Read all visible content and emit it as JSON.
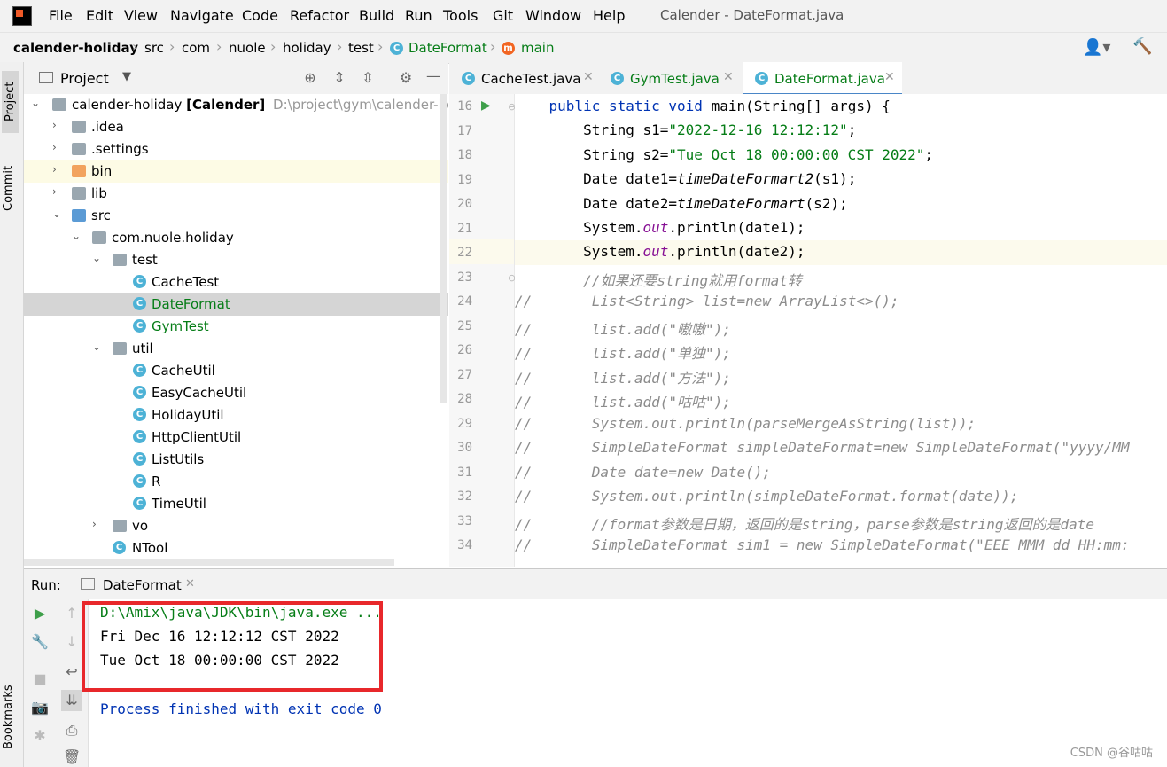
{
  "menu": [
    "File",
    "Edit",
    "View",
    "Navigate",
    "Code",
    "Refactor",
    "Build",
    "Run",
    "Tools",
    "Git",
    "Window",
    "Help"
  ],
  "window_title": "Calender - DateFormat.java",
  "breadcrumb": [
    "calender-holiday",
    "src",
    "com",
    "nuole",
    "holiday",
    "test",
    "DateFormat",
    "main"
  ],
  "left_stripe": {
    "project": "Project",
    "commit": "Commit",
    "bookmarks": "Bookmarks"
  },
  "project_panel": {
    "title": "Project"
  },
  "tree": [
    {
      "label": "calender-holiday",
      "bold": "[Calender]",
      "path": "D:\\project\\gym\\calender-holi"
    },
    {
      "label": ".idea"
    },
    {
      "label": ".settings"
    },
    {
      "label": "bin"
    },
    {
      "label": "lib"
    },
    {
      "label": "src"
    },
    {
      "label": "com.nuole.holiday"
    },
    {
      "label": "test"
    },
    {
      "label": "CacheTest"
    },
    {
      "label": "DateFormat"
    },
    {
      "label": "GymTest"
    },
    {
      "label": "util"
    },
    {
      "label": "CacheUtil"
    },
    {
      "label": "EasyCacheUtil"
    },
    {
      "label": "HolidayUtil"
    },
    {
      "label": "HttpClientUtil"
    },
    {
      "label": "ListUtils"
    },
    {
      "label": "R"
    },
    {
      "label": "TimeUtil"
    },
    {
      "label": "vo"
    },
    {
      "label": "NTool"
    }
  ],
  "editor_tabs": [
    "CacheTest.java",
    "GymTest.java",
    "DateFormat.java"
  ],
  "line_numbers": [
    "16",
    "17",
    "18",
    "19",
    "20",
    "21",
    "22",
    "23",
    "24",
    "25",
    "26",
    "27",
    "28",
    "29",
    "30",
    "31",
    "32",
    "33",
    "34"
  ],
  "code": {
    "l16": [
      "public static void ",
      "main(String[] args) {"
    ],
    "l17": [
      "String s1=",
      "\"2022-12-16 12:12:12\"",
      ";"
    ],
    "l18": [
      "String s2=",
      "\"Tue Oct 18 00:00:00 CST 2022\"",
      ";"
    ],
    "l19": [
      "Date date1=",
      "timeDateFormart2",
      "(s1);"
    ],
    "l20": [
      "Date date2=",
      "timeDateFormart",
      "(s2);"
    ],
    "l21": [
      "System.",
      "out",
      ".println(date1);"
    ],
    "l22": [
      "System.",
      "out",
      ".println(date2);"
    ],
    "l23": "//如果还要string就用format转",
    "l24": [
      "//",
      "    List<String> list=new ArrayList<>();"
    ],
    "l25": [
      "//",
      "    list.add(\"嗷嗷\");"
    ],
    "l26": [
      "//",
      "    list.add(\"单独\");"
    ],
    "l27": [
      "//",
      "    list.add(\"方法\");"
    ],
    "l28": [
      "//",
      "    list.add(\"咕咕\");"
    ],
    "l29": [
      "//",
      "    System.out.println(parseMergeAsString(list));"
    ],
    "l30": [
      "//",
      "    SimpleDateFormat simpleDateFormat=new SimpleDateFormat(\"yyyy/MM"
    ],
    "l31": [
      "//",
      "    Date date=new Date();"
    ],
    "l32": [
      "//",
      "    System.out.println(simpleDateFormat.format(date));"
    ],
    "l33": [
      "//",
      "    //format参数是日期，返回的是string，parse参数是string返回的是date"
    ],
    "l34": [
      "//",
      "    SimpleDateFormat sim1 = new SimpleDateFormat(\"EEE MMM dd HH:mm:"
    ]
  },
  "run": {
    "label": "Run:",
    "tab": "DateFormat"
  },
  "console": {
    "cmd": "D:\\Amix\\java\\JDK\\bin\\java.exe ...",
    "out1": "Fri Dec 16 12:12:12 CST 2022",
    "out2": "Tue Oct 18 00:00:00 CST 2022",
    "exit": "Process finished with exit code 0"
  },
  "watermark": "CSDN @谷咕咕",
  "colors": {
    "keyword": "#0033b3",
    "string": "#067d17",
    "field": "#871094",
    "comment": "#8c8c8c",
    "highlight_box": "#e8282b",
    "selected_row": "#d5d5d5",
    "current_line": "#fcfaed"
  }
}
